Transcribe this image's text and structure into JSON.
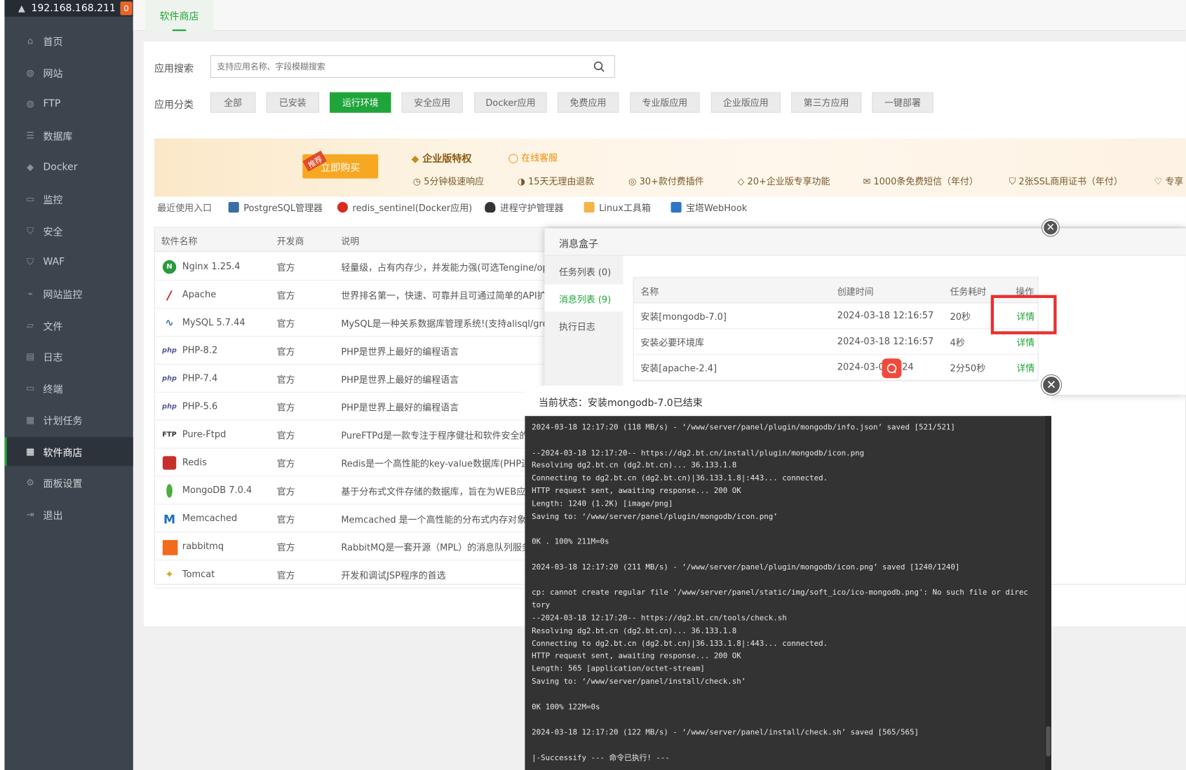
{
  "server": {
    "ip": "192.168.168.211",
    "badge": "0"
  },
  "nav": [
    {
      "label": "首页",
      "icon": "home-icon"
    },
    {
      "label": "网站",
      "icon": "globe-icon"
    },
    {
      "label": "FTP",
      "icon": "ftp-icon"
    },
    {
      "label": "数据库",
      "icon": "database-icon"
    },
    {
      "label": "Docker",
      "icon": "docker-icon"
    },
    {
      "label": "监控",
      "icon": "monitor-icon"
    },
    {
      "label": "安全",
      "icon": "shield-icon"
    },
    {
      "label": "WAF",
      "icon": "waf-icon"
    },
    {
      "label": "网站监控",
      "icon": "chart-icon"
    },
    {
      "label": "文件",
      "icon": "folder-icon"
    },
    {
      "label": "日志",
      "icon": "log-icon"
    },
    {
      "label": "终端",
      "icon": "terminal-icon"
    },
    {
      "label": "计划任务",
      "icon": "calendar-icon"
    },
    {
      "label": "软件商店",
      "icon": "grid-icon"
    },
    {
      "label": "面板设置",
      "icon": "gear-icon"
    },
    {
      "label": "退出",
      "icon": "logout-icon"
    }
  ],
  "tab": {
    "label": "软件商店"
  },
  "search": {
    "label": "应用搜索",
    "placeholder": "支持应用名称、字段模糊搜索"
  },
  "categories": {
    "label": "应用分类",
    "items": [
      "全部",
      "已安装",
      "运行环境",
      "安全应用",
      "Docker应用",
      "免费应用",
      "专业版应用",
      "企业版应用",
      "第三方应用",
      "一键部署"
    ],
    "active": "运行环境"
  },
  "banner": {
    "ribbon": "推荐",
    "buy": "立即购买",
    "title": "企业版特权",
    "service": "在线客服",
    "perks": [
      "5分钟极速响应",
      "15天无理由退款",
      "30+款付费插件",
      "20+企业版专享功能",
      "1000条免费短信（年付）",
      "2张SSL商用证书（年付）",
      "专享"
    ]
  },
  "recent": {
    "label": "最近使用入口",
    "items": [
      "PostgreSQL管理器",
      "redis_sentinel(Docker应用)",
      "进程守护管理器",
      "Linux工具箱",
      "宝塔WebHook"
    ]
  },
  "table": {
    "headers": [
      "软件名称",
      "开发商",
      "说明"
    ],
    "rows": [
      {
        "name": "Nginx 1.25.4",
        "dev": "官方",
        "desc": "轻量级，占有内存少，并发能力强(可选Tengine/openresty)"
      },
      {
        "name": "Apache",
        "dev": "官方",
        "desc": "世界排名第一，快速、可靠并且可通过简单的API扩充"
      },
      {
        "name": "MySQL 5.7.44",
        "dev": "官方",
        "desc": "MySQL是一种关系数据库管理系统!(支持alisql/greatsql)"
      },
      {
        "name": "PHP-8.2",
        "dev": "官方",
        "desc": "PHP是世界上最好的编程语言"
      },
      {
        "name": "PHP-7.4",
        "dev": "官方",
        "desc": "PHP是世界上最好的编程语言"
      },
      {
        "name": "PHP-5.6",
        "dev": "官方",
        "desc": "PHP是世界上最好的编程语言"
      },
      {
        "name": "Pure-Ftpd",
        "dev": "官方",
        "desc": "PureFTPd是一款专注于程序健壮和软件安全的免费FTP服务器"
      },
      {
        "name": "Redis",
        "dev": "官方",
        "desc": "Redis是一个高性能的key-value数据库(PHP连接Redis)"
      },
      {
        "name": "MongoDB 7.0.4",
        "dev": "官方",
        "desc": "基于分布式文件存储的数据库，旨在为WEB应用提供"
      },
      {
        "name": "Memcached",
        "dev": "官方",
        "desc": "Memcached 是一个高性能的分布式内存对象缓存系统"
      },
      {
        "name": "rabbitmq",
        "dev": "官方",
        "desc": "RabbitMQ是一套开源（MPL）的消息队列服务软件"
      },
      {
        "name": "Tomcat",
        "dev": "官方",
        "desc": "开发和调试JSP程序的首选"
      }
    ]
  },
  "msgbox": {
    "title": "消息盒子",
    "tabs": [
      "任务列表 (0)",
      "消息列表 (9)",
      "执行日志"
    ],
    "headers": [
      "名称",
      "创建时间",
      "任务耗时",
      "操作"
    ],
    "rows": [
      {
        "name": "安装[mongodb-7.0]",
        "time": "2024-03-18 12:16:57",
        "cost": "20秒",
        "op": "详情"
      },
      {
        "name": "安装必要环境库",
        "time": "2024-03-18 12:16:57",
        "cost": "4秒",
        "op": "详情"
      },
      {
        "name": "安装[apache-2.4]",
        "time": "2024-03-0",
        "time_tail": "5:24",
        "cost": "2分50秒",
        "op": "详情"
      }
    ]
  },
  "log": {
    "status": "当前状态：安装mongodb-7.0已结束",
    "lines": "2024-03-18 12:17:20 (118 MB/s) - ‘/www/server/panel/plugin/mongodb/info.json’ saved [521/521]\n\n--2024-03-18 12:17:20-- https://dg2.bt.cn/install/plugin/mongodb/icon.png\nResolving dg2.bt.cn (dg2.bt.cn)... 36.133.1.8\nConnecting to dg2.bt.cn (dg2.bt.cn)|36.133.1.8|:443... connected.\nHTTP request sent, awaiting response... 200 OK\nLength: 1240 (1.2K) [image/png]\nSaving to: ‘/www/server/panel/plugin/mongodb/icon.png’\n\n0K . 100% 211M=0s\n\n2024-03-18 12:17:20 (211 MB/s) - ‘/www/server/panel/plugin/mongodb/icon.png’ saved [1240/1240]\n\ncp: cannot create regular file '/www/server/panel/static/img/soft_ico/ico-mongodb.png': No such file or direc\ntory\n--2024-03-18 12:17:20-- https://dg2.bt.cn/tools/check.sh\nResolving dg2.bt.cn (dg2.bt.cn)... 36.133.1.8\nConnecting to dg2.bt.cn (dg2.bt.cn)|36.133.1.8|:443... connected.\nHTTP request sent, awaiting response... 200 OK\nLength: 565 [application/octet-stream]\nSaving to: ‘/www/server/panel/install/check.sh’\n\n0K 100% 122M=0s\n\n2024-03-18 12:17:20 (122 MB/s) - ‘/www/server/panel/install/check.sh’ saved [565/565]\n\n|-Successify --- 命令已执行! ---"
  },
  "colors": {
    "accent": "#20a53a",
    "sidebar": "#3c444d",
    "highlight": "#ea2f2f",
    "console": "#333333"
  }
}
